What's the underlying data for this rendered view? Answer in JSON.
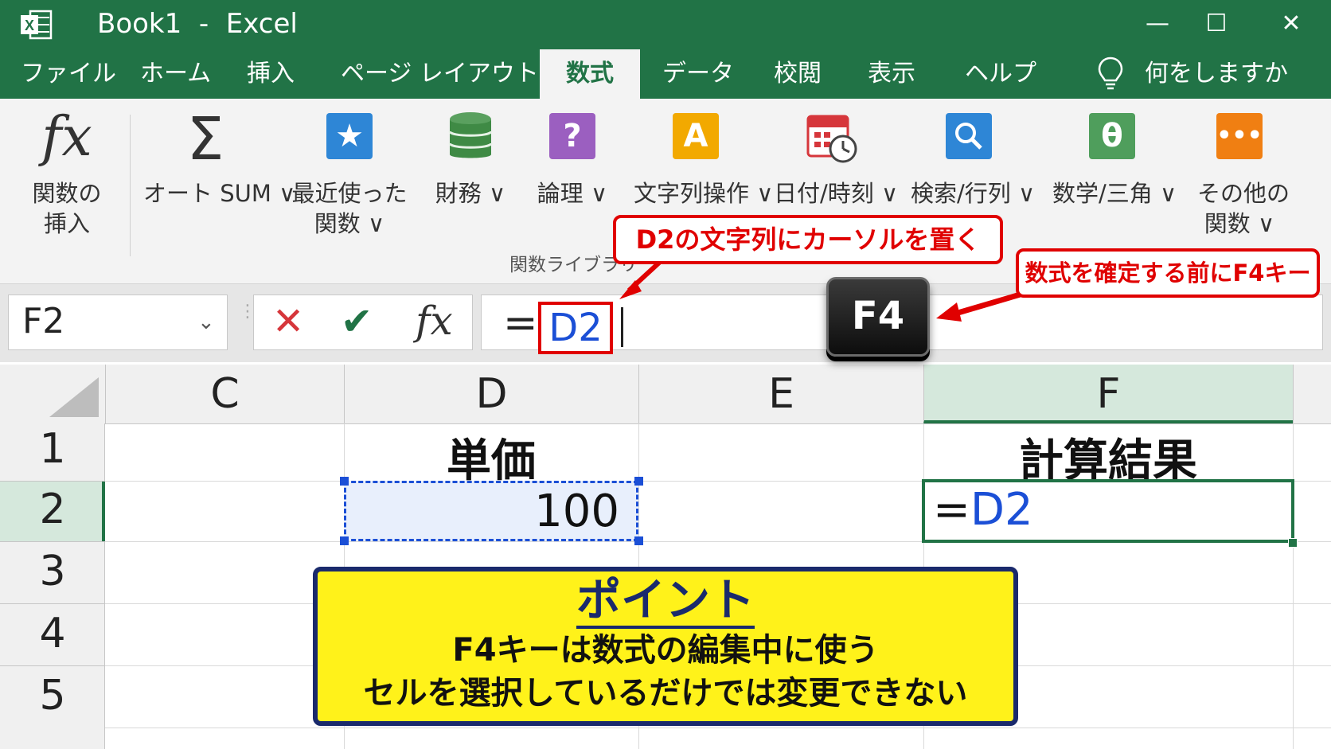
{
  "window": {
    "title": "Book1  -  Excel",
    "app_icon": "excel-icon",
    "controls": [
      "—",
      "☐",
      "✕"
    ]
  },
  "menu": {
    "tabs": [
      "ファイル",
      "ホーム",
      "挿入",
      "ページ レイアウト",
      "数式",
      "データ",
      "校閲",
      "表示",
      "ヘルプ"
    ],
    "active_tab": "数式",
    "tell_me": "何をしますか"
  },
  "ribbon": {
    "buttons": [
      {
        "icon": "fx-icon",
        "label1": "関数の",
        "label2": "挿入"
      },
      {
        "icon": "sigma-icon",
        "label1": "オート SUM ∨",
        "label2": ""
      },
      {
        "icon": "star-icon",
        "label1": "最近使った",
        "label2": "関数 ∨"
      },
      {
        "icon": "database-icon",
        "label1": "財務 ∨",
        "label2": ""
      },
      {
        "icon": "question-icon",
        "label1": "論理 ∨",
        "label2": ""
      },
      {
        "icon": "text-icon",
        "label1": "文字列操作 ∨",
        "label2": ""
      },
      {
        "icon": "calendar-clock-icon",
        "label1": "日付/時刻 ∨",
        "label2": ""
      },
      {
        "icon": "magnifier-icon",
        "label1": "検索/行列 ∨",
        "label2": ""
      },
      {
        "icon": "theta-icon",
        "label1": "数学/三角 ∨",
        "label2": ""
      },
      {
        "icon": "more-icon",
        "label1": "その他の",
        "label2": "関数 ∨"
      }
    ],
    "icon_glyphs": {
      "fx": "fx",
      "sigma": "Σ",
      "star": "★",
      "question": "?",
      "text": "A",
      "theta": "θ",
      "more": "•••"
    },
    "group_label": "関数ライブラリ"
  },
  "formula_bar": {
    "name_box": "F2",
    "cancel": "✕",
    "enter": "✔",
    "fx": "fx",
    "eq": "=",
    "ref": "D2"
  },
  "sheet": {
    "columns": [
      "C",
      "D",
      "E",
      "F"
    ],
    "rows": [
      "1",
      "2",
      "3",
      "4",
      "5"
    ],
    "d1": "単価",
    "d2": "100",
    "f1": "計算結果",
    "f2_eq": "=",
    "f2_ref": "D2"
  },
  "annotations": {
    "callout1": "D2の文字列にカーソルを置く",
    "callout2": "数式を確定する前にF4キー",
    "key": "F4",
    "point_title": "ポイント",
    "point_line1": "F4キーは数式の編集中に使う",
    "point_line2": "セルを選択しているだけでは変更できない"
  },
  "colors": {
    "excel_green": "#217346",
    "reference_blue": "#1b4fd6",
    "callout_red": "#e00000",
    "point_yellow": "#fff21a",
    "point_border": "#1a2a6c"
  }
}
